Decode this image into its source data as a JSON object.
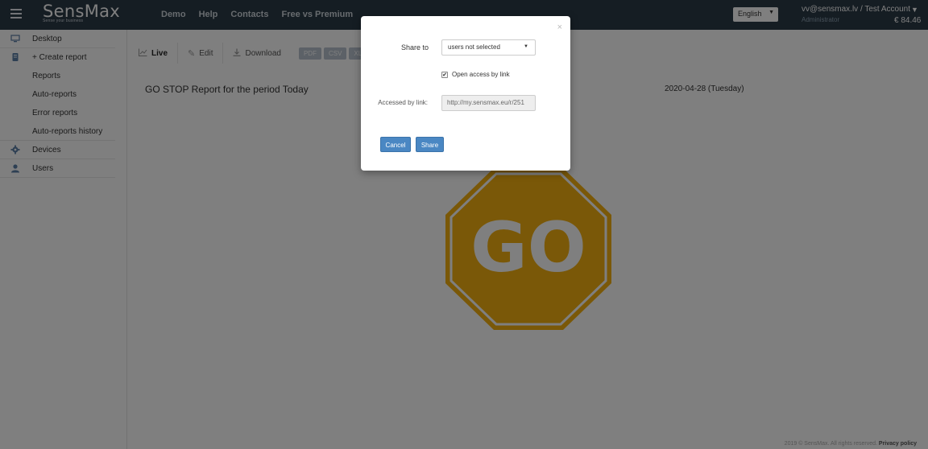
{
  "header": {
    "logo_text": "SensMax",
    "logo_tagline": "Sense your business",
    "nav": [
      "Demo",
      "Help",
      "Contacts",
      "Free vs Premium"
    ],
    "language": "English",
    "account": "vv@sensmax.lv / Test Account",
    "account_role": "Administrator",
    "balance": "€ 84.46"
  },
  "sidebar": {
    "items": [
      {
        "label": "Desktop",
        "icon": "monitor-icon"
      },
      {
        "label": "+ Create report",
        "icon": "report-icon"
      },
      {
        "label": "Reports"
      },
      {
        "label": "Auto-reports"
      },
      {
        "label": "Error reports"
      },
      {
        "label": "Auto-reports history"
      },
      {
        "label": "Devices",
        "icon": "gear-icon"
      },
      {
        "label": "Users",
        "icon": "user-icon"
      }
    ]
  },
  "toolbar": {
    "live": "Live",
    "edit": "Edit",
    "download": "Download",
    "formats": [
      "PDF",
      "CSV",
      "XLS"
    ]
  },
  "report": {
    "title": "GO STOP Report for the period Today",
    "date": "2020-04-28 (Tuesday)",
    "sign_text": "GO",
    "sign_color": "#c9860a"
  },
  "footer": {
    "copyright": "2019 © SensMax. All rights reserved.",
    "privacy": "Privacy policy"
  },
  "modal": {
    "close": "×",
    "share_to_label": "Share to",
    "share_to_value": "users not selected",
    "open_access_label": "Open access by link",
    "open_access_checked": true,
    "accessed_by_link_label": "Accessed by link:",
    "link_value": "http://my.sensmax.eu/r/251",
    "cancel_label": "Cancel",
    "share_label": "Share"
  },
  "colors": {
    "topbar": "#2b3a47",
    "accent_button": "#4a87c3",
    "sidebar_icon": "#5a7ea6"
  }
}
